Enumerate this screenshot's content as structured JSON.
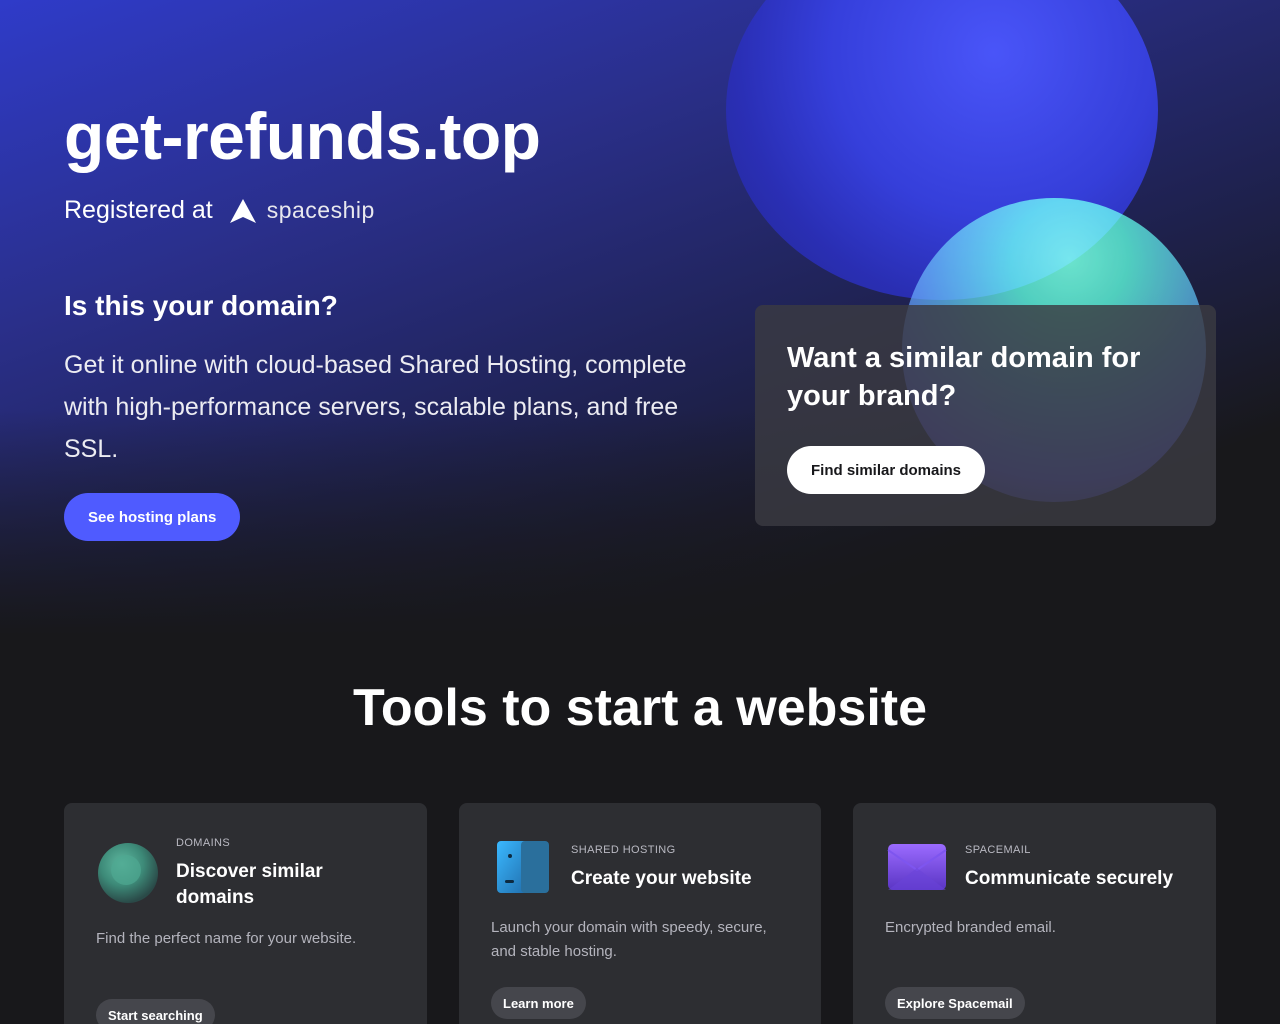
{
  "colors": {
    "accent": "#4f5bff",
    "background": "#18181b",
    "card": "#2d2e32",
    "orb_blue": "#3640e0",
    "orb_green": "#3ed8b4"
  },
  "hero": {
    "domain": "get-refunds.top",
    "registered_label": "Registered at",
    "brand_name": "spaceship",
    "brand_icon": "spaceship-logo-icon",
    "question": "Is this your domain?",
    "description": "Get it online with cloud-based Shared Hosting, complete with high-performance servers, scalable plans, and free SSL.",
    "cta_label": "See hosting plans"
  },
  "similar": {
    "title": "Want a similar domain for your brand?",
    "button_label": "Find similar domains"
  },
  "tools": {
    "heading": "Tools to start a website",
    "cards": [
      {
        "icon": "domains-orb-icon",
        "category": "DOMAINS",
        "title": "Discover similar domains",
        "description": "Find the perfect name for your website.",
        "button_label": "Start searching"
      },
      {
        "icon": "server-icon",
        "category": "SHARED HOSTING",
        "title": "Create your website",
        "description": "Launch your domain with speedy, secure, and stable hosting.",
        "button_label": "Learn more"
      },
      {
        "icon": "envelope-icon",
        "category": "SPACEMAIL",
        "title": "Communicate securely",
        "description": "Encrypted branded email.",
        "button_label": "Explore Spacemail"
      }
    ]
  }
}
